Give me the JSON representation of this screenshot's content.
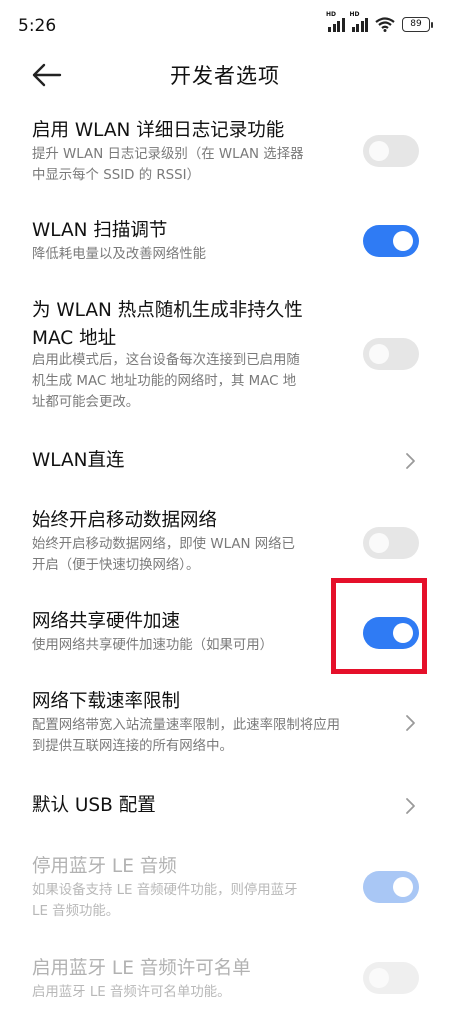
{
  "status": {
    "time": "5:26",
    "battery": "89",
    "hd1": "HD",
    "hd2": "HD"
  },
  "header": {
    "title": "开发者选项"
  },
  "settings": [
    {
      "title": "启用 WLAN 详细日志记录功能",
      "desc": "提升 WLAN 日志记录级别（在 WLAN 选择器\n中显示每个 SSID 的 RSSI）",
      "control": "toggle",
      "state": "off"
    },
    {
      "title": "WLAN 扫描调节",
      "desc": "降低耗电量以及改善网络性能",
      "control": "toggle",
      "state": "on"
    },
    {
      "title": "为 WLAN 热点随机生成非持久性\nMAC 地址",
      "desc": "启用此模式后，这台设备每次连接到已启用随\n机生成 MAC 地址功能的网络时，其 MAC 地\n址都可能会更改。",
      "control": "toggle",
      "state": "off"
    },
    {
      "title": "WLAN直连",
      "desc": "",
      "control": "chevron"
    },
    {
      "title": "始终开启移动数据网络",
      "desc": "始终开启移动数据网络，即使 WLAN 网络已\n开启（便于快速切换网络）。",
      "control": "toggle",
      "state": "off"
    },
    {
      "title": "网络共享硬件加速",
      "desc": "使用网络共享硬件加速功能（如果可用）",
      "control": "toggle",
      "state": "on"
    },
    {
      "title": "网络下载速率限制",
      "desc": "配置网络带宽入站流量速率限制，此速率限制将应用\n到提供互联网连接的所有网络中。",
      "control": "chevron"
    },
    {
      "title": "默认 USB 配置",
      "desc": "",
      "control": "chevron"
    },
    {
      "title": "停用蓝牙 LE 音频",
      "desc": "如果设备支持 LE 音频硬件功能，则停用蓝牙\nLE 音频功能。",
      "control": "toggle",
      "state": "on",
      "disabled": true
    },
    {
      "title": "启用蓝牙 LE 音频许可名单",
      "desc": "启用蓝牙 LE 音频许可名单功能。",
      "control": "toggle",
      "state": "off",
      "disabled": true
    }
  ],
  "colors": {
    "toggle_on": "#2f7bf4",
    "toggle_off": "#e6e6e6",
    "highlight": "#e5102a"
  }
}
